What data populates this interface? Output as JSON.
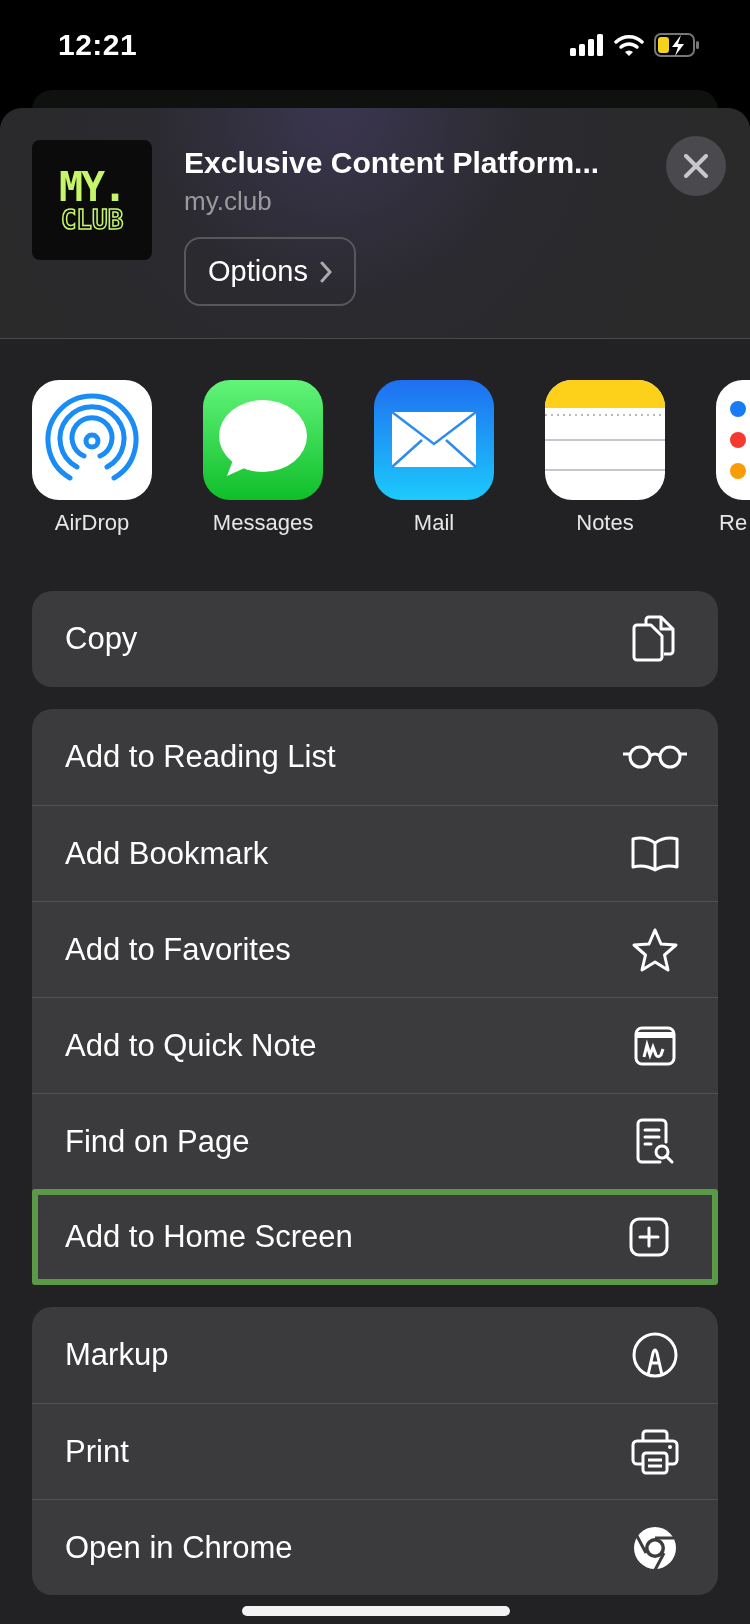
{
  "status_bar": {
    "time": "12:21"
  },
  "header": {
    "title": "Exclusive Content Platform...",
    "subtitle": "my.club",
    "options_button": "Options",
    "logo_text": {
      "top": "MY.",
      "bottom": "CLUB"
    }
  },
  "apps": [
    {
      "label": "AirDrop"
    },
    {
      "label": "Messages"
    },
    {
      "label": "Mail"
    },
    {
      "label": "Notes"
    },
    {
      "label": "Re",
      "partial": true
    }
  ],
  "action_groups": [
    {
      "items": [
        {
          "label": "Copy",
          "highlighted": false
        }
      ]
    },
    {
      "items": [
        {
          "label": "Add to Reading List",
          "highlighted": false
        },
        {
          "label": "Add Bookmark",
          "highlighted": false
        },
        {
          "label": "Add to Favorites",
          "highlighted": false
        },
        {
          "label": "Add to Quick Note",
          "highlighted": false
        },
        {
          "label": "Find on Page",
          "highlighted": false
        },
        {
          "label": "Add to Home Screen",
          "highlighted": true
        }
      ]
    },
    {
      "items": [
        {
          "label": "Markup",
          "highlighted": false
        },
        {
          "label": "Print",
          "highlighted": false
        },
        {
          "label": "Open in Chrome",
          "highlighted": false
        }
      ]
    }
  ]
}
